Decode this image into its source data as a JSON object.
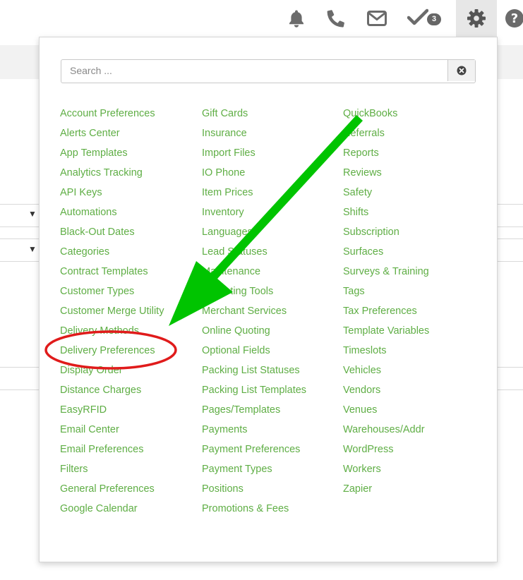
{
  "header": {
    "icons": [
      "bell-icon",
      "phone-icon",
      "envelope-icon",
      "checkmark-icon",
      "gear-icon",
      "help-icon"
    ],
    "tasks_badge": "3"
  },
  "search": {
    "placeholder": "Search ..."
  },
  "menu": {
    "columns": [
      [
        "Account Preferences",
        "Alerts Center",
        "App Templates",
        "Analytics Tracking",
        "API Keys",
        "Automations",
        "Black-Out Dates",
        "Categories",
        "Contract Templates",
        "Customer Types",
        "Customer Merge Utility",
        "Delivery Methods",
        "Delivery Preferences",
        "Display Order",
        "Distance Charges",
        "EasyRFID",
        "Email Center",
        "Email Preferences",
        "Filters",
        "General Preferences",
        "Google Calendar"
      ],
      [
        "Gift Cards",
        "Insurance",
        "Import Files",
        "IO Phone",
        "Item Prices",
        "Inventory",
        "Languages",
        "Lead Statuses",
        "Maintenance",
        "Marketing Tools",
        "Merchant Services",
        "Online Quoting",
        "Optional Fields",
        "Packing List Statuses",
        "Packing List Templates",
        "Pages/Templates",
        "Payments",
        "Payment Preferences",
        "Payment Types",
        "Positions",
        "Promotions & Fees"
      ],
      [
        "QuickBooks",
        "Referrals",
        "Reports",
        "Reviews",
        "Safety",
        "Shifts",
        "Subscription",
        "Surfaces",
        "Surveys & Training",
        "Tags",
        "Tax Preferences",
        "Template Variables",
        "Timeslots",
        "Vehicles",
        "Vendors",
        "Venues",
        "Warehouses/Addr",
        "WordPress",
        "Workers",
        "Zapier"
      ]
    ]
  },
  "annotations": {
    "arrow_color": "#00c400",
    "highlight_color": "#e01b1b"
  }
}
